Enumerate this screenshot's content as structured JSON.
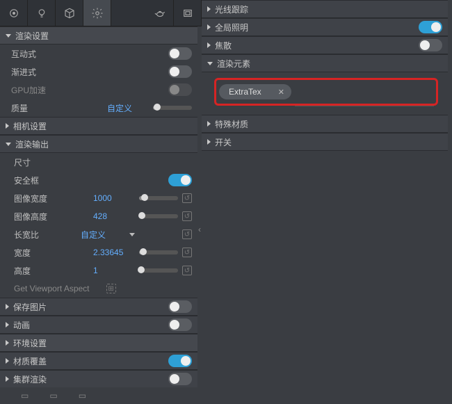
{
  "left": {
    "sections": {
      "render_settings": "渲染设置",
      "camera_settings": "相机设置",
      "render_output": "渲染输出",
      "save_image": "保存图片",
      "animation": "动画",
      "env_settings": "环境设置",
      "mat_override": "材质覆盖",
      "cluster_render": "集群渲染"
    },
    "rows": {
      "interactive": "互动式",
      "progressive": "渐进式",
      "gpu": "GPU加速",
      "quality": "质量",
      "quality_val": "自定义",
      "size": "尺寸",
      "safe_frame": "安全框",
      "img_w": "图像宽度",
      "img_w_val": "1000",
      "img_h": "图像高度",
      "img_h_val": "428",
      "aspect_lock": "长宽比",
      "aspect_lock_val": "自定义",
      "width": "宽度",
      "width_val": "2.33645",
      "height": "高度",
      "height_val": "1",
      "viewport": "Get Viewport Aspect"
    }
  },
  "right": {
    "sections": {
      "ray_trace": "光线跟踪",
      "gi": "全局照明",
      "caustics": "焦散",
      "render_elements": "渲染元素",
      "special_mat": "特殊材质",
      "switches": "开关"
    },
    "chip": "ExtraTex"
  }
}
